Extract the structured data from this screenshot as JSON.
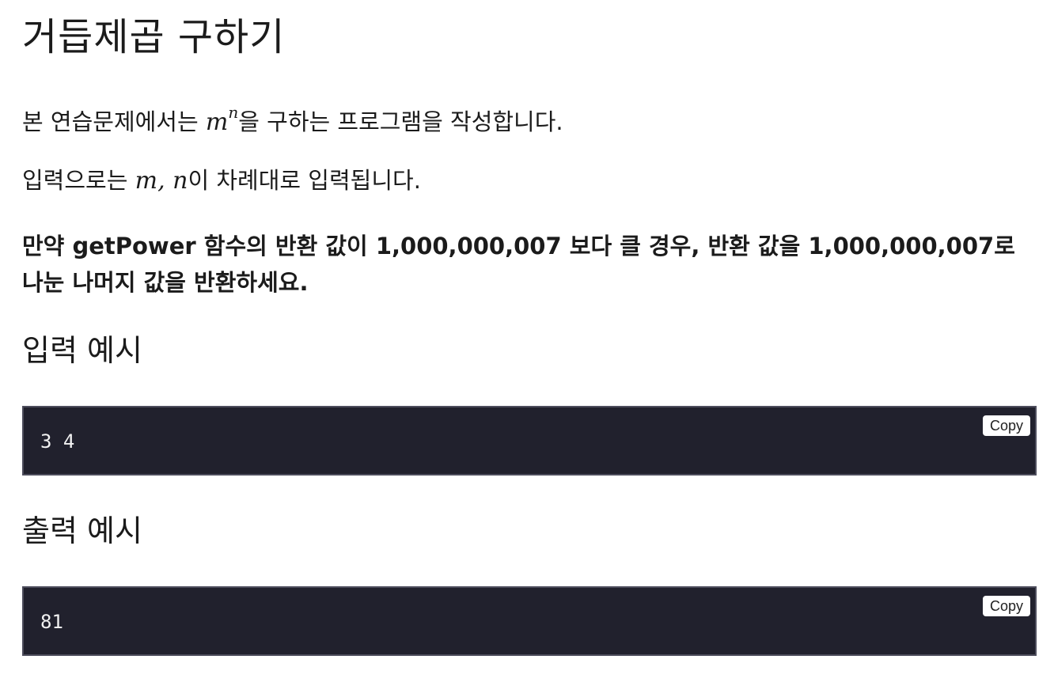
{
  "problem": {
    "title": "거듭제곱 구하기",
    "p1_before": "본 연습문제에서는 ",
    "p1_math_base": "m",
    "p1_math_exp": "n",
    "p1_after": "을 구하는 프로그램을 작성합니다.",
    "p2_before": "입력으로는 ",
    "p2_math": "m, n",
    "p2_after": "이 차례대로 입력됩니다.",
    "warning": "만약 getPower 함수의 반환 값이 1,000,000,007 보다 클 경우, 반환 값을 1,000,000,007로 나눈 나머지 값을 반환하세요."
  },
  "input_example": {
    "heading": "입력 예시",
    "code": "3 4",
    "copy_label": "Copy"
  },
  "output_example": {
    "heading": "출력 예시",
    "code": "81",
    "copy_label": "Copy"
  },
  "colors": {
    "code_background": "#21212d",
    "code_border": "#4d4d5c",
    "code_text": "#f2f2f2"
  }
}
